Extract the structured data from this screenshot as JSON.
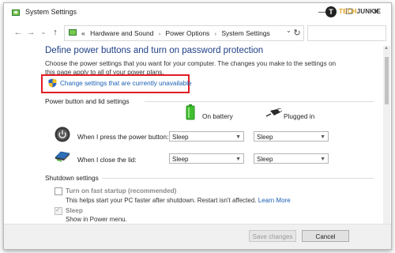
{
  "window": {
    "title": "System Settings",
    "minimize_glyph": "—",
    "maximize_glyph": "☐",
    "close_glyph": "✕"
  },
  "brand": {
    "circle_letter": "T",
    "name_a": "TECH",
    "name_b": "JUNKIE"
  },
  "address_bar": {
    "back_glyph": "←",
    "forward_glyph": "→",
    "recent_glyph": "⌄",
    "up_glyph": "↑",
    "breadcrumbs": [
      "«",
      "Hardware and Sound",
      "Power Options",
      "System Settings"
    ],
    "separator": "›",
    "dropdown_glyph": "⌄",
    "refresh_glyph": "↻",
    "search_value": ""
  },
  "main": {
    "heading": "Define power buttons and turn on password protection",
    "description": "Choose the power settings that you want for your computer. The changes you make to the settings on this page apply to all of your power plans.",
    "change_link": "Change settings that are currently unavailable"
  },
  "power_section": {
    "title": "Power button and lid settings",
    "col_battery": "On battery",
    "col_plugged": "Plugged in",
    "rows": [
      {
        "label": "When I press the power button:",
        "battery": "Sleep",
        "plugged": "Sleep"
      },
      {
        "label": "When I close the lid:",
        "battery": "Sleep",
        "plugged": "Sleep"
      }
    ]
  },
  "shutdown_section": {
    "title": "Shutdown settings",
    "fast_startup": {
      "label": "Turn on fast startup (recommended)",
      "description": "This helps start your PC faster after shutdown. Restart isn't affected.",
      "learn_more": "Learn More",
      "checked": false
    },
    "sleep": {
      "label": "Sleep",
      "description": "Show in Power menu.",
      "checked": true
    }
  },
  "footer": {
    "save_label": "Save changes",
    "cancel_label": "Cancel"
  },
  "colors": {
    "heading": "#1e3f86",
    "link": "#1a5fb4",
    "highlight_box": "#e21d23",
    "battery_green": "#3fbf2f"
  }
}
